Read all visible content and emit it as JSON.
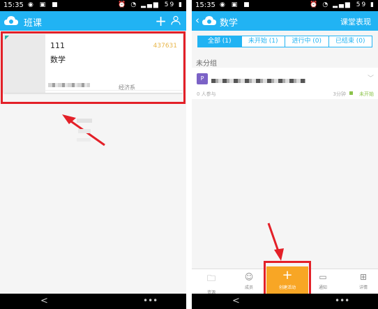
{
  "status": {
    "time": "15:35",
    "battery": "59"
  },
  "left": {
    "appbar": {
      "title": "班课",
      "add_icon": "+",
      "profile_icon": "person-icon"
    },
    "card": {
      "name": "111",
      "code": "437631",
      "subject": "数学",
      "department": "经济系"
    }
  },
  "right": {
    "appbar": {
      "title": "数学",
      "action": "课堂表现"
    },
    "tabs": [
      {
        "label": "全部 (1)",
        "active": true
      },
      {
        "label": "未开始 (1)",
        "active": false
      },
      {
        "label": "进行中 (0)",
        "active": false
      },
      {
        "label": "已结束 (0)",
        "active": false
      }
    ],
    "group_label": "未分组",
    "item": {
      "participants": "0 人参与",
      "time": "3分钟",
      "status": "未开始",
      "status_color": "#8bc34a"
    },
    "bottom": {
      "resources": "资源",
      "members": "成员",
      "create": "创建活动",
      "create_icon": "+",
      "notice": "通知",
      "details": "详情"
    }
  },
  "nav": {
    "back": "<",
    "menu": "•••"
  },
  "colors": {
    "primary": "#21b3f3",
    "highlight": "#e32028",
    "create_button": "#f8a625"
  }
}
